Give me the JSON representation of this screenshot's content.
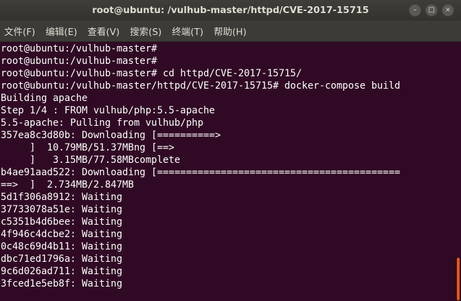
{
  "window": {
    "title": "root@ubuntu: /vulhub-master/httpd/CVE-2017-15715",
    "minimize_glyph": "–",
    "maximize_glyph": "□",
    "close_glyph": "×"
  },
  "menu": {
    "file": "文件(F)",
    "edit": "编辑(E)",
    "view": "查看(V)",
    "search": "搜索(S)",
    "terminal": "终端(T)",
    "help": "帮助(H)"
  },
  "terminal": {
    "lines": [
      "root@ubuntu:/vulhub-master#",
      "root@ubuntu:/vulhub-master#",
      "root@ubuntu:/vulhub-master# cd httpd/CVE-2017-15715/",
      "root@ubuntu:/vulhub-master/httpd/CVE-2017-15715# docker-compose build",
      "Building apache",
      "Step 1/4 : FROM vulhub/php:5.5-apache",
      "5.5-apache: Pulling from vulhub/php",
      "357ea8c3d80b: Downloading [==========>",
      "     ]  10.79MB/51.37MBng [==>",
      "     ]   3.15MB/77.58MBcomplete",
      "b4ae91aad522: Downloading [==========================================",
      "==>  ]  2.734MB/2.847MB",
      "5d1f306a8912: Waiting",
      "37733078a51e: Waiting",
      "c5351b4d6bee: Waiting",
      "4f946c4dcbe2: Waiting",
      "0c48c69d4b11: Waiting",
      "dbc71ed1796a: Waiting",
      "9c6d026ad711: Waiting",
      "3fced1e5eb8f: Waiting"
    ]
  },
  "colors": {
    "terminal_bg": "#300a24",
    "text": "#ffffff",
    "titlebar": "#3f3e39",
    "scroll_thumb": "#e8590c"
  }
}
